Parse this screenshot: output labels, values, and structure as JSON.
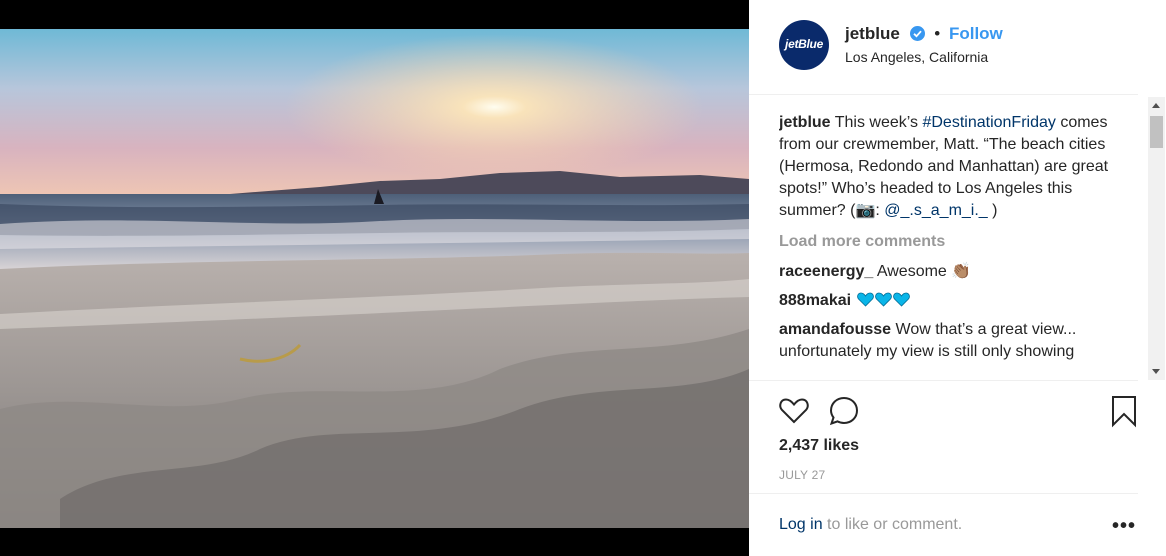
{
  "post": {
    "username": "jetblue",
    "avatar_text": "jetBlue",
    "dot": "•",
    "follow_label": "Follow",
    "location": "Los Angeles, California"
  },
  "caption": {
    "username": "jetblue",
    "text_1": "This week’s",
    "hashtag": "#DestinationFriday",
    "text_2": "comes from our crewmember, Matt. “The beach cities (Hermosa, Redondo and Manhattan) are great spots!” Who’s headed to Los Angeles this summer? (",
    "camera_emoji": "📷",
    "text_3": ":",
    "mention": "@_.s_a_m_i._",
    "text_4": ")"
  },
  "load_more_label": "Load more comments",
  "comments": [
    {
      "username": "raceenergy_",
      "text": "Awesome",
      "emoji": "👏🏽"
    },
    {
      "username": "888makai",
      "text": ""
    },
    {
      "username": "amandafousse",
      "text": "Wow that’s a great view... unfortunately my view is still only showing"
    }
  ],
  "likes": "2,437 likes",
  "date": "JULY 27",
  "footer": {
    "login_label": "Log in",
    "rest": "to like or comment.",
    "more": "•••"
  },
  "icons": {
    "like": "heart-outline-icon",
    "comment": "speech-bubble-icon",
    "save": "bookmark-icon",
    "verified": "verified-badge-icon"
  },
  "colors": {
    "accent": "#3897f0",
    "link": "#003569",
    "muted": "#999999",
    "heart": "#0ab5e8"
  }
}
